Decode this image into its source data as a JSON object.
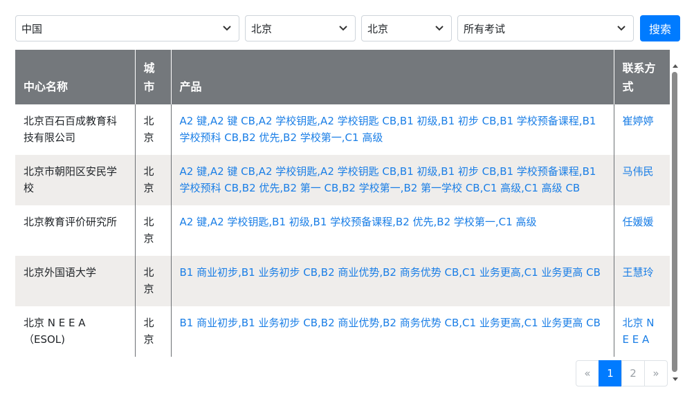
{
  "filters": {
    "country": "中国",
    "province": "北京",
    "city": "北京",
    "exam": "所有考试",
    "search_label": "搜索"
  },
  "table": {
    "headers": [
      "中心名称",
      "城市",
      "产品",
      "联系方式"
    ],
    "rows": [
      {
        "name": "北京百石百成教育科技有限公司",
        "city": "北京",
        "products": "A2 键,A2 键 CB,A2 学校钥匙,A2 学校钥匙 CB,B1 初级,B1 初步 CB,B1 学校预备课程,B1 学校预科 CB,B2 优先,B2 学校第一,C1 高级",
        "contact": "崔婷婷"
      },
      {
        "name": "北京市朝阳区安民学校",
        "city": "北京",
        "products": "A2 键,A2 键 CB,A2 学校钥匙,A2 学校钥匙 CB,B1 初级,B1 初步 CB,B1 学校预备课程,B1 学校预科 CB,B2 优先,B2 第一 CB,B2 学校第一,B2 第一学校 CB,C1 高级,C1 高级 CB",
        "contact": "马伟民"
      },
      {
        "name": "北京教育评价研究所",
        "city": "北京",
        "products": "A2 键,A2 学校钥匙,B1 初级,B1 学校预备课程,B2 优先,B2 学校第一,C1 高级",
        "contact": "任媛媛"
      },
      {
        "name": "北京外国语大学",
        "city": "北京",
        "products": "B1 商业初步,B1 业务初步 CB,B2 商业优势,B2 商务优势 CB,C1 业务更高,C1 业务更高 CB",
        "contact": "王慧玲"
      },
      {
        "name": "北京 N E E A （ESOL)",
        "city": "北京",
        "products": "B1 商业初步,B1 业务初步 CB,B2 商业优势,B2 商务优势 CB,C1 业务更高,C1 业务更高 CB",
        "contact": "北京 N E E A"
      }
    ]
  },
  "pagination": {
    "prev": "«",
    "pages": [
      "1",
      "2"
    ],
    "next": "»",
    "active": "1"
  },
  "icons": {
    "select_arrow": "chevron-down-icon",
    "scroll_up": "scroll-up-arrow-icon",
    "scroll_down": "scroll-down-arrow-icon"
  },
  "colors": {
    "primary": "#007bff",
    "header_bg": "#74787c",
    "link": "#1a7ee6",
    "row_alt": "#efedeb"
  }
}
